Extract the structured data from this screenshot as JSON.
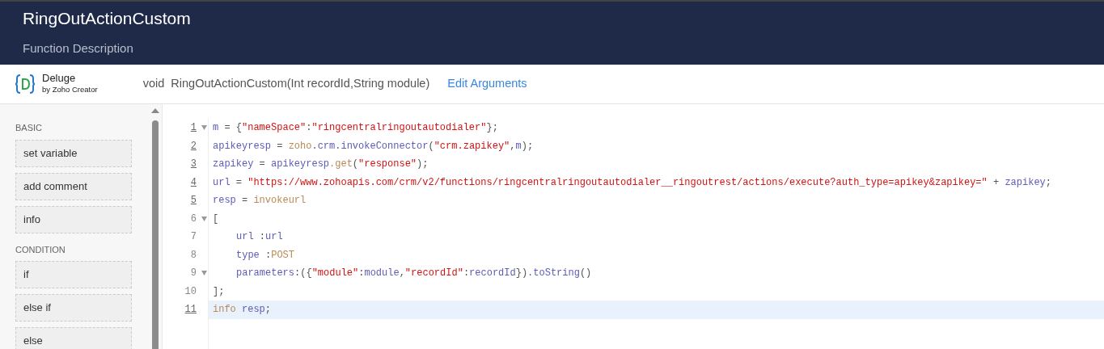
{
  "header": {
    "title": "RingOutActionCustom",
    "description": "Function Description"
  },
  "toolbar": {
    "logo_name": "Deluge",
    "logo_sub": "by Zoho Creator",
    "return_type": "void",
    "signature": "RingOutActionCustom(Int recordId,String module)",
    "edit_link": "Edit Arguments"
  },
  "sidebar": {
    "groups": [
      {
        "heading": "BASIC",
        "items": [
          "set variable",
          "add comment",
          "info"
        ]
      },
      {
        "heading": "CONDITION",
        "items": [
          "if",
          "else if",
          "else"
        ]
      }
    ]
  },
  "editor": {
    "lines": [
      {
        "number": "1",
        "underlined": true,
        "fold": true,
        "selected": false,
        "tokens": [
          {
            "kind": "var",
            "text": "m"
          },
          {
            "kind": "punct",
            "text": " = {"
          },
          {
            "kind": "string",
            "text": "\"nameSpace\""
          },
          {
            "kind": "punct",
            "text": ":"
          },
          {
            "kind": "string",
            "text": "\"ringcentralringoutautodialer\""
          },
          {
            "kind": "punct",
            "text": "};"
          }
        ]
      },
      {
        "number": "2",
        "underlined": true,
        "fold": false,
        "selected": false,
        "tokens": [
          {
            "kind": "var",
            "text": "apikeyresp"
          },
          {
            "kind": "punct",
            "text": " = "
          },
          {
            "kind": "builtin",
            "text": "zoho"
          },
          {
            "kind": "var",
            "text": ".crm.invokeConnector"
          },
          {
            "kind": "punct",
            "text": "("
          },
          {
            "kind": "string",
            "text": "\"crm.zapikey\""
          },
          {
            "kind": "punct",
            "text": ","
          },
          {
            "kind": "var",
            "text": "m"
          },
          {
            "kind": "punct",
            "text": ");"
          }
        ]
      },
      {
        "number": "3",
        "underlined": true,
        "fold": false,
        "selected": false,
        "tokens": [
          {
            "kind": "var",
            "text": "zapikey"
          },
          {
            "kind": "punct",
            "text": " = "
          },
          {
            "kind": "var",
            "text": "apikeyresp"
          },
          {
            "kind": "builtin",
            "text": ".get"
          },
          {
            "kind": "punct",
            "text": "("
          },
          {
            "kind": "string",
            "text": "\"response\""
          },
          {
            "kind": "punct",
            "text": ");"
          }
        ]
      },
      {
        "number": "4",
        "underlined": true,
        "fold": false,
        "selected": false,
        "tokens": [
          {
            "kind": "var",
            "text": "url"
          },
          {
            "kind": "punct",
            "text": " = "
          },
          {
            "kind": "string",
            "text": "\"https://www.zohoapis.com/crm/v2/functions/ringcentralringoutautodialer__ringoutrest/actions/execute?auth_type=apikey&zapikey=\""
          },
          {
            "kind": "punct",
            "text": " + "
          },
          {
            "kind": "var",
            "text": "zapikey"
          },
          {
            "kind": "punct",
            "text": ";"
          }
        ]
      },
      {
        "number": "5",
        "underlined": true,
        "fold": false,
        "selected": false,
        "tokens": [
          {
            "kind": "var",
            "text": "resp"
          },
          {
            "kind": "punct",
            "text": " = "
          },
          {
            "kind": "builtin",
            "text": "invokeurl"
          }
        ]
      },
      {
        "number": "6",
        "underlined": false,
        "fold": true,
        "selected": false,
        "tokens": [
          {
            "kind": "punct",
            "text": "["
          }
        ]
      },
      {
        "number": "7",
        "underlined": false,
        "fold": false,
        "selected": false,
        "indented": true,
        "tokens": [
          {
            "kind": "var",
            "text": "url"
          },
          {
            "kind": "punct",
            "text": " :"
          },
          {
            "kind": "var",
            "text": "url"
          }
        ]
      },
      {
        "number": "8",
        "underlined": false,
        "fold": false,
        "selected": false,
        "indented": true,
        "tokens": [
          {
            "kind": "var",
            "text": "type"
          },
          {
            "kind": "punct",
            "text": " :"
          },
          {
            "kind": "builtin",
            "text": "POST"
          }
        ]
      },
      {
        "number": "9",
        "underlined": false,
        "fold": true,
        "selected": false,
        "indented": true,
        "tokens": [
          {
            "kind": "var",
            "text": "parameters"
          },
          {
            "kind": "punct",
            "text": ":({"
          },
          {
            "kind": "string",
            "text": "\"module\""
          },
          {
            "kind": "punct",
            "text": ":"
          },
          {
            "kind": "var",
            "text": "module"
          },
          {
            "kind": "punct",
            "text": ","
          },
          {
            "kind": "string",
            "text": "\"recordId\""
          },
          {
            "kind": "punct",
            "text": ":"
          },
          {
            "kind": "var",
            "text": "recordId"
          },
          {
            "kind": "punct",
            "text": "})"
          },
          {
            "kind": "var",
            "text": ".toString"
          },
          {
            "kind": "punct",
            "text": "()"
          }
        ]
      },
      {
        "number": "10",
        "underlined": false,
        "fold": false,
        "selected": false,
        "tokens": [
          {
            "kind": "punct",
            "text": "];"
          }
        ]
      },
      {
        "number": "11",
        "underlined": true,
        "fold": false,
        "selected": true,
        "tokens": [
          {
            "kind": "builtin",
            "text": "info"
          },
          {
            "kind": "var",
            "text": " resp"
          },
          {
            "kind": "punct",
            "text": ";"
          }
        ]
      }
    ]
  }
}
